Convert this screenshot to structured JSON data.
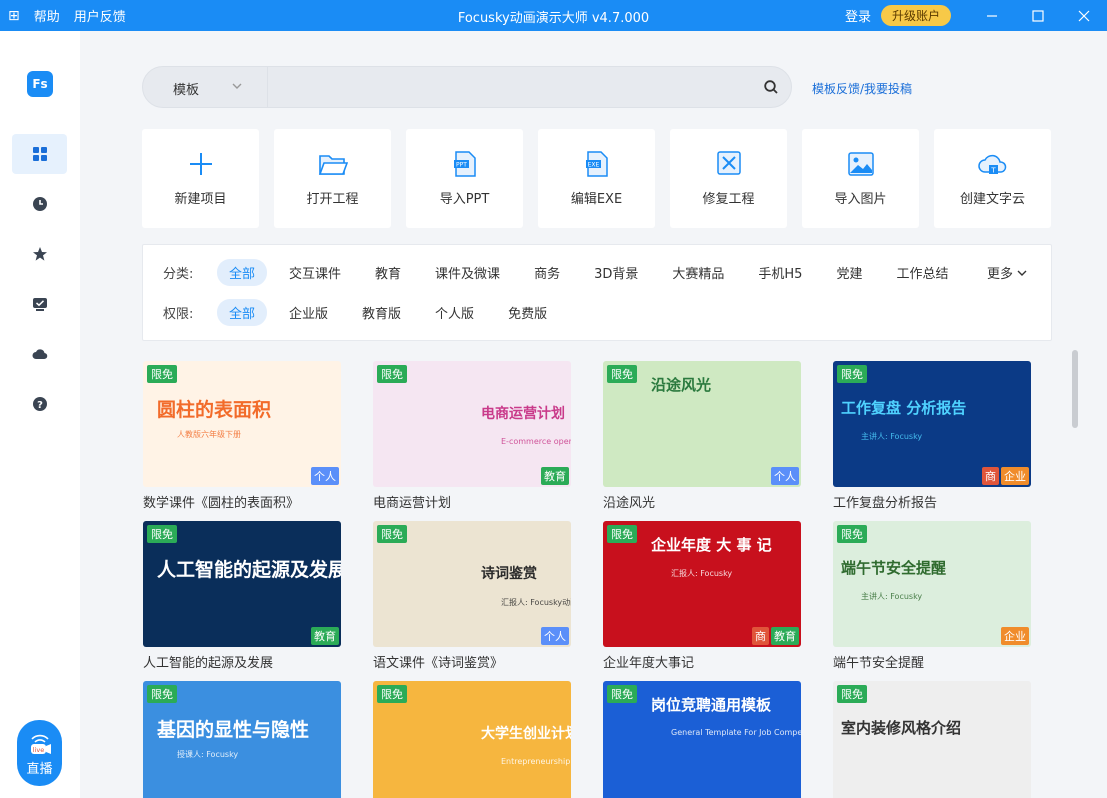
{
  "titlebar": {
    "menu": [
      "帮助",
      "用户反馈"
    ],
    "title": "Focusky动画演示大师 v4.7.000",
    "login": "登录",
    "upgrade": "升级账户"
  },
  "sidebar": {
    "logo": "Fs",
    "items": [
      {
        "icon": "grid-icon"
      },
      {
        "icon": "clock-icon"
      },
      {
        "icon": "star-icon"
      },
      {
        "icon": "checklist-icon"
      },
      {
        "icon": "cloud-icon"
      },
      {
        "icon": "help-icon"
      }
    ],
    "live": {
      "badge": "live",
      "label": "直播"
    }
  },
  "search": {
    "category": "模板",
    "placeholder": "",
    "feedback_link": "模板反馈/我要投稿"
  },
  "actions": [
    {
      "label": "新建项目",
      "icon": "plus-icon"
    },
    {
      "label": "打开工程",
      "icon": "folder-icon"
    },
    {
      "label": "导入PPT",
      "icon": "ppt-file-icon",
      "icon_text": "PPT"
    },
    {
      "label": "编辑EXE",
      "icon": "exe-file-icon",
      "icon_text": "EXE"
    },
    {
      "label": "修复工程",
      "icon": "repair-icon"
    },
    {
      "label": "导入图片",
      "icon": "image-icon"
    },
    {
      "label": "创建文字云",
      "icon": "word-cloud-icon",
      "icon_text": "T"
    }
  ],
  "filters": {
    "category_label": "分类:",
    "categories": [
      "全部",
      "交互课件",
      "教育",
      "课件及微课",
      "商务",
      "3D背景",
      "大赛精品",
      "手机H5",
      "党建",
      "工作总结"
    ],
    "more": "更多",
    "permission_label": "权限:",
    "permissions": [
      "全部",
      "企业版",
      "教育版",
      "个人版",
      "免费版"
    ]
  },
  "templates": [
    {
      "title": "数学课件《圆柱的表面积》",
      "thumb_text": "圆柱的表面积",
      "thumb_sub": "人教版六年级下册",
      "free": "限免",
      "tags": [
        {
          "t": "个人",
          "k": "personal"
        }
      ],
      "bg": "#fff3e6",
      "accent": "#f26b2a"
    },
    {
      "title": "电商运营计划",
      "thumb_text": "电商运营计划",
      "thumb_sub": "E-commerce operation plan",
      "free": "限免",
      "tags": [
        {
          "t": "教育",
          "k": "edu"
        }
      ],
      "bg": "#f5e6f2",
      "accent": "#c93a8a"
    },
    {
      "title": "沿途风光",
      "thumb_text": "沿途风光",
      "thumb_sub": "",
      "free": "限免",
      "tags": [
        {
          "t": "个人",
          "k": "personal"
        }
      ],
      "bg": "#cfe9c2",
      "accent": "#2b7a3e"
    },
    {
      "title": "工作复盘分析报告",
      "thumb_text": "工作复盘 分析报告",
      "thumb_sub": "主讲人: Focusky",
      "free": "限免",
      "tags": [
        {
          "t": "商",
          "k": "biz"
        },
        {
          "t": "企业",
          "k": "ent"
        }
      ],
      "bg": "#0b3a86",
      "accent": "#4fd2ff"
    },
    {
      "title": "人工智能的起源及发展",
      "thumb_text": "人工智能的起源及发展",
      "thumb_sub": "",
      "free": "限免",
      "tags": [
        {
          "t": "教育",
          "k": "edu"
        }
      ],
      "bg": "#0a2e5a",
      "accent": "#ffffff"
    },
    {
      "title": "语文课件《诗词鉴赏》",
      "thumb_text": "诗词鉴赏",
      "thumb_sub": "汇报人: Focusky动画演示大师",
      "free": "限免",
      "tags": [
        {
          "t": "个人",
          "k": "personal"
        }
      ],
      "bg": "#ece4d2",
      "accent": "#2a2a2a"
    },
    {
      "title": "企业年度大事记",
      "thumb_text": "企业年度 大 事 记",
      "thumb_sub": "汇报人: Focusky",
      "free": "限免",
      "tags": [
        {
          "t": "商",
          "k": "biz"
        },
        {
          "t": "教育",
          "k": "edu"
        }
      ],
      "bg": "#c8101d",
      "accent": "#ffffff"
    },
    {
      "title": "端午节安全提醒",
      "thumb_text": "端午节安全提醒",
      "thumb_sub": "主讲人: Focusky",
      "free": "限免",
      "tags": [
        {
          "t": "企业",
          "k": "ent"
        }
      ],
      "bg": "#dceedd",
      "accent": "#2f6b2f"
    },
    {
      "title": "",
      "thumb_text": "基因的显性与隐性",
      "thumb_sub": "授课人: Focusky",
      "free": "限免",
      "tags": [],
      "bg": "#3b8fe0",
      "accent": "#ffffff"
    },
    {
      "title": "",
      "thumb_text": "大学生创业计划书",
      "thumb_sub": "Entrepreneurship",
      "free": "限免",
      "tags": [],
      "bg": "#f6b63f",
      "accent": "#ffffff"
    },
    {
      "title": "",
      "thumb_text": "岗位竞聘通用模板",
      "thumb_sub": "General Template For Job Competition",
      "free": "限免",
      "tags": [],
      "bg": "#1b5fd6",
      "accent": "#ffffff"
    },
    {
      "title": "",
      "thumb_text": "室内装修风格介绍",
      "thumb_sub": "",
      "free": "限免",
      "tags": [],
      "bg": "#eeeeee",
      "accent": "#333333"
    }
  ]
}
